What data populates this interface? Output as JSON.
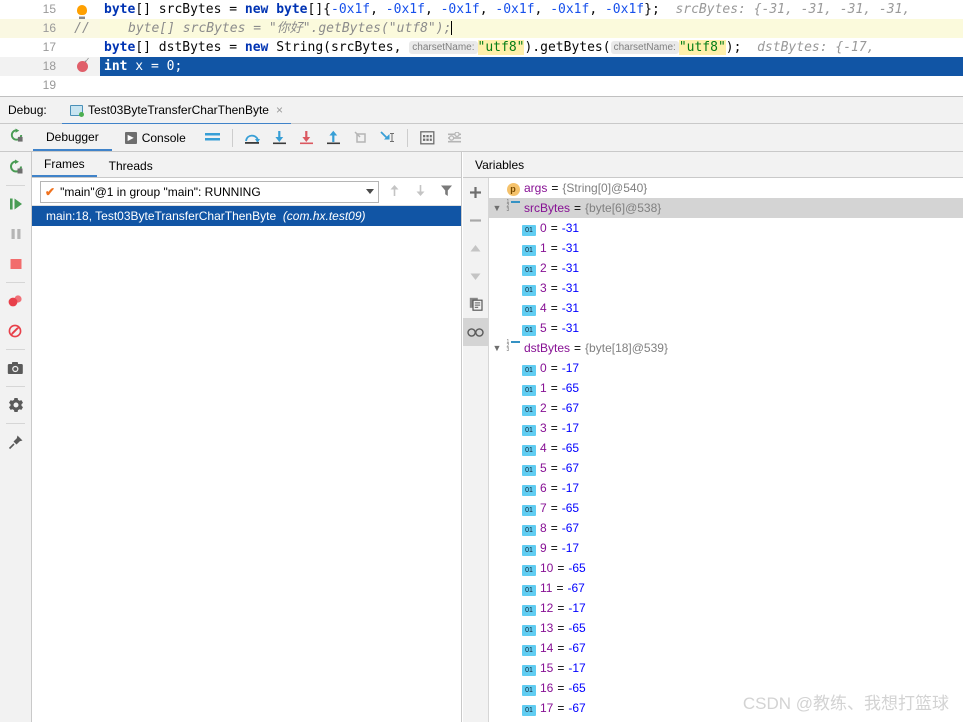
{
  "editor": {
    "lines": [
      {
        "number": "15",
        "gutter_icon": "lightbulb-icon",
        "tokens": "byte[] srcBytes = new byte[]{-0x1f,  -0x1f, -0x1f, -0x1f, -0x1f, -0x1f};",
        "inline_hint": "srcBytes: {-31, -31, -31, -31,"
      },
      {
        "number": "16",
        "gutter_icon": "comment-slashes",
        "tokens": "byte[] srcBytes = \"你好\".getBytes(\"utf8\");",
        "inline_hint": ""
      },
      {
        "number": "17",
        "gutter_icon": "",
        "tokens": "byte[] dstBytes = new String(srcBytes, charsetName: \"utf8\").getBytes( charsetName: \"utf8\");",
        "inline_hint": "dstBytes: {-17,"
      },
      {
        "number": "18",
        "gutter_icon": "breakpoint-icon",
        "tokens": "int x = 0;",
        "inline_hint": ""
      }
    ],
    "line15": {
      "t1": "byte",
      "t2": "[] srcBytes = ",
      "t3": "new",
      "t4": " byte",
      "t5": "[]{",
      "n1": "-0x1f",
      "c1": ",  ",
      "n2": "-0x1f",
      "c2": ", ",
      "n3": "-0x1f",
      "c3": ", ",
      "n4": "-0x1f",
      "c4": ", ",
      "n5": "-0x1f",
      "c5": ", ",
      "n6": "-0x1f",
      "t6": "};",
      "hint": "srcBytes: {-31, -31, -31, -31,"
    },
    "line16": {
      "slashes": "//",
      "text": "byte[] srcBytes = \"你好\".getBytes(\"utf8\");"
    },
    "line17": {
      "t1": "byte",
      "t2": "[] dstBytes = ",
      "t3": "new",
      "t4": " String(srcBytes, ",
      "hint1": "charsetName:",
      "s1": "\"utf8\"",
      "t5": ").getBytes(",
      "hint2": "charsetName:",
      "s2": "\"utf8\"",
      "t6": ");",
      "hint": "dstBytes: {-17,"
    },
    "line18": {
      "t1": "int",
      "t2": " x = ",
      "n1": "0",
      "t3": ";"
    }
  },
  "debug_tabbar": {
    "label": "Debug:",
    "tab_name": "Test03ByteTransferCharThenByte",
    "close_glyph": "×"
  },
  "debug_toolbar": {
    "rerun_icon": "rerun-icon",
    "tabs": [
      {
        "label": "Debugger",
        "active": true
      },
      {
        "label": "Console",
        "active": false
      }
    ],
    "console_icon_glyph": "▶",
    "buttons": [
      {
        "name": "layout-settings-icon"
      },
      {
        "name": "step-over-icon"
      },
      {
        "name": "step-into-icon"
      },
      {
        "name": "force-step-into-icon"
      },
      {
        "name": "step-out-icon"
      },
      {
        "name": "drop-frame-icon"
      },
      {
        "name": "run-to-cursor-icon"
      },
      {
        "name": "evaluate-expression-icon"
      },
      {
        "name": "settings-list-icon"
      }
    ]
  },
  "left_rail": {
    "buttons": [
      {
        "name": "rerun-button"
      },
      {
        "name": "resume-program-button"
      },
      {
        "name": "pause-program-button"
      },
      {
        "name": "stop-button"
      },
      {
        "name": "view-breakpoints-button"
      },
      {
        "name": "mute-breakpoints-button"
      },
      {
        "name": "screenshot-button"
      },
      {
        "name": "settings-button"
      },
      {
        "name": "pin-tab-button"
      }
    ]
  },
  "frames_pane": {
    "tabs": [
      {
        "label": "Frames",
        "active": true
      },
      {
        "label": "Threads",
        "active": false
      }
    ],
    "thread_selector": {
      "value": "\"main\"@1 in group \"main\": RUNNING",
      "check_glyph": "✔"
    },
    "nav_buttons": [
      {
        "name": "frame-up-button",
        "glyph": "↑"
      },
      {
        "name": "frame-down-button",
        "glyph": "↓"
      },
      {
        "name": "filter-frames-button",
        "glyph": "▼"
      }
    ],
    "frames": [
      {
        "location": "main:18, Test03ByteTransferCharThenByte",
        "package": "(com.hx.test09)",
        "selected": true
      }
    ]
  },
  "vars_pane": {
    "header": "Variables",
    "rail_buttons": [
      {
        "name": "add-watch-button",
        "glyph": "+"
      },
      {
        "name": "remove-watch-button",
        "glyph": "−"
      },
      {
        "name": "move-up-button",
        "glyph": "▲"
      },
      {
        "name": "move-down-button",
        "glyph": "▼"
      },
      {
        "name": "copy-value-button",
        "glyph": "copy-icon"
      },
      {
        "name": "inspect-button",
        "glyph": "glasses-icon"
      }
    ],
    "rows": [
      {
        "depth": 0,
        "twisty": "",
        "icon": "param",
        "name": "args",
        "eq": "=",
        "value": "{String[0]@540}",
        "value_kind": "ref",
        "selected": false
      },
      {
        "depth": 0,
        "twisty": "▼",
        "icon": "array",
        "name": "srcBytes",
        "eq": "=",
        "value": "{byte[6]@538}",
        "value_kind": "ref",
        "selected": true
      },
      {
        "depth": 1,
        "twisty": "",
        "icon": "prim",
        "name": "0",
        "eq": "=",
        "value": "-31",
        "value_kind": "num",
        "selected": false
      },
      {
        "depth": 1,
        "twisty": "",
        "icon": "prim",
        "name": "1",
        "eq": "=",
        "value": "-31",
        "value_kind": "num",
        "selected": false
      },
      {
        "depth": 1,
        "twisty": "",
        "icon": "prim",
        "name": "2",
        "eq": "=",
        "value": "-31",
        "value_kind": "num",
        "selected": false
      },
      {
        "depth": 1,
        "twisty": "",
        "icon": "prim",
        "name": "3",
        "eq": "=",
        "value": "-31",
        "value_kind": "num",
        "selected": false
      },
      {
        "depth": 1,
        "twisty": "",
        "icon": "prim",
        "name": "4",
        "eq": "=",
        "value": "-31",
        "value_kind": "num",
        "selected": false
      },
      {
        "depth": 1,
        "twisty": "",
        "icon": "prim",
        "name": "5",
        "eq": "=",
        "value": "-31",
        "value_kind": "num",
        "selected": false
      },
      {
        "depth": 0,
        "twisty": "▼",
        "icon": "array",
        "name": "dstBytes",
        "eq": "=",
        "value": "{byte[18]@539}",
        "value_kind": "ref",
        "selected": false
      },
      {
        "depth": 1,
        "twisty": "",
        "icon": "prim",
        "name": "0",
        "eq": "=",
        "value": "-17",
        "value_kind": "num",
        "selected": false
      },
      {
        "depth": 1,
        "twisty": "",
        "icon": "prim",
        "name": "1",
        "eq": "=",
        "value": "-65",
        "value_kind": "num",
        "selected": false
      },
      {
        "depth": 1,
        "twisty": "",
        "icon": "prim",
        "name": "2",
        "eq": "=",
        "value": "-67",
        "value_kind": "num",
        "selected": false
      },
      {
        "depth": 1,
        "twisty": "",
        "icon": "prim",
        "name": "3",
        "eq": "=",
        "value": "-17",
        "value_kind": "num",
        "selected": false
      },
      {
        "depth": 1,
        "twisty": "",
        "icon": "prim",
        "name": "4",
        "eq": "=",
        "value": "-65",
        "value_kind": "num",
        "selected": false
      },
      {
        "depth": 1,
        "twisty": "",
        "icon": "prim",
        "name": "5",
        "eq": "=",
        "value": "-67",
        "value_kind": "num",
        "selected": false
      },
      {
        "depth": 1,
        "twisty": "",
        "icon": "prim",
        "name": "6",
        "eq": "=",
        "value": "-17",
        "value_kind": "num",
        "selected": false
      },
      {
        "depth": 1,
        "twisty": "",
        "icon": "prim",
        "name": "7",
        "eq": "=",
        "value": "-65",
        "value_kind": "num",
        "selected": false
      },
      {
        "depth": 1,
        "twisty": "",
        "icon": "prim",
        "name": "8",
        "eq": "=",
        "value": "-67",
        "value_kind": "num",
        "selected": false
      },
      {
        "depth": 1,
        "twisty": "",
        "icon": "prim",
        "name": "9",
        "eq": "=",
        "value": "-17",
        "value_kind": "num",
        "selected": false
      },
      {
        "depth": 1,
        "twisty": "",
        "icon": "prim",
        "name": "10",
        "eq": "=",
        "value": "-65",
        "value_kind": "num",
        "selected": false
      },
      {
        "depth": 1,
        "twisty": "",
        "icon": "prim",
        "name": "11",
        "eq": "=",
        "value": "-67",
        "value_kind": "num",
        "selected": false
      },
      {
        "depth": 1,
        "twisty": "",
        "icon": "prim",
        "name": "12",
        "eq": "=",
        "value": "-17",
        "value_kind": "num",
        "selected": false
      },
      {
        "depth": 1,
        "twisty": "",
        "icon": "prim",
        "name": "13",
        "eq": "=",
        "value": "-65",
        "value_kind": "num",
        "selected": false
      },
      {
        "depth": 1,
        "twisty": "",
        "icon": "prim",
        "name": "14",
        "eq": "=",
        "value": "-67",
        "value_kind": "num",
        "selected": false
      },
      {
        "depth": 1,
        "twisty": "",
        "icon": "prim",
        "name": "15",
        "eq": "=",
        "value": "-17",
        "value_kind": "num",
        "selected": false
      },
      {
        "depth": 1,
        "twisty": "",
        "icon": "prim",
        "name": "16",
        "eq": "=",
        "value": "-65",
        "value_kind": "num",
        "selected": false
      },
      {
        "depth": 1,
        "twisty": "",
        "icon": "prim",
        "name": "17",
        "eq": "=",
        "value": "-67",
        "value_kind": "num",
        "selected": false
      }
    ]
  },
  "watermark": "CSDN @教练、我想打篮球",
  "colors": {
    "selection_blue": "#1155a5",
    "accent_blue": "#4083c9",
    "keyword_blue": "#0033b3",
    "string_green": "#067d17",
    "number_blue": "#1750eb",
    "name_purple": "#871094",
    "panel_grey": "#f2f2f2"
  }
}
